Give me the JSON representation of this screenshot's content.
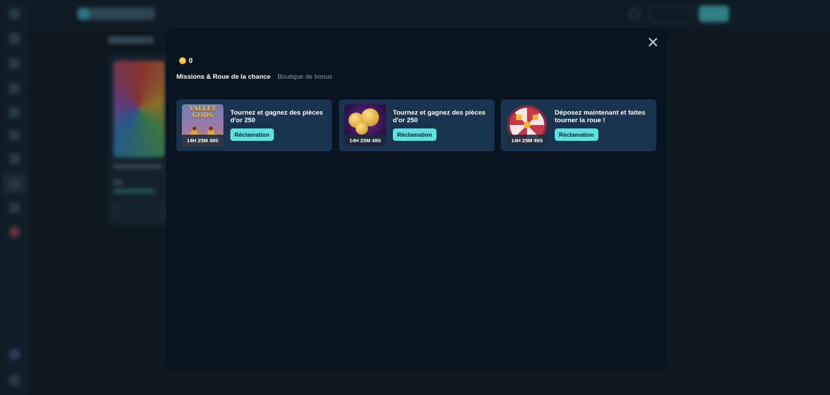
{
  "modal": {
    "coin_balance": "0",
    "tabs": [
      {
        "label": "Missions & Roue de la chance",
        "active": true
      },
      {
        "label": "Boutique de bonus",
        "active": false
      }
    ],
    "missions": [
      {
        "thumbnail": "valley-of-the-gods",
        "thumb_title": "VALLEY GODS",
        "timer": "14H 25M 49S",
        "title": "Tournez et gagnez des pièces d'or 250",
        "button_label": "Réclamation"
      },
      {
        "thumbnail": "gold-coins",
        "timer": "14H 25M 49S",
        "title": "Tournez et gagnez des pièces d'or 250",
        "button_label": "Réclamation"
      },
      {
        "thumbnail": "fortune-wheel",
        "timer": "14H 25M 49S",
        "title": "Déposez maintenant et faites tourner la roue !",
        "button_label": "Réclamation"
      }
    ]
  },
  "colors": {
    "accent": "#5ce0e0",
    "modal_bg": "#081520",
    "card_bg": "#1a3450",
    "coin": "#f2b632"
  }
}
